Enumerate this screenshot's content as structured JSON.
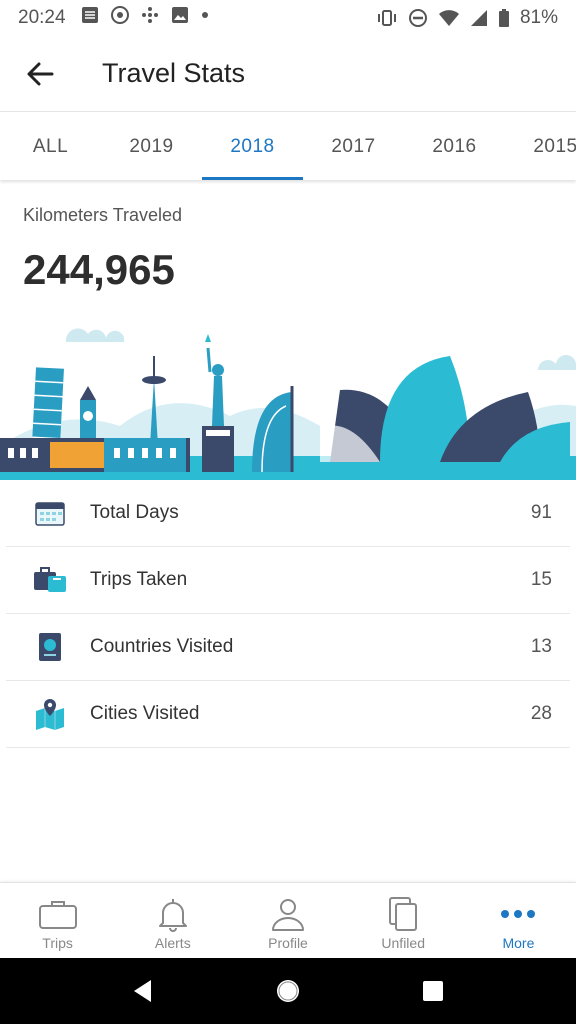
{
  "status_bar": {
    "time": "20:24",
    "battery_percent": "81%"
  },
  "app_bar": {
    "title": "Travel Stats"
  },
  "tabs": [
    {
      "label": "ALL",
      "active": false
    },
    {
      "label": "2019",
      "active": false
    },
    {
      "label": "2018",
      "active": true
    },
    {
      "label": "2017",
      "active": false
    },
    {
      "label": "2016",
      "active": false
    },
    {
      "label": "2015",
      "active": false
    }
  ],
  "kilometers": {
    "label": "Kilometers Traveled",
    "value": "244,965"
  },
  "stats": [
    {
      "label": "Total Days",
      "value": "91",
      "icon": "calendar-icon"
    },
    {
      "label": "Trips Taken",
      "value": "15",
      "icon": "luggage-icon"
    },
    {
      "label": "Countries Visited",
      "value": "13",
      "icon": "passport-icon"
    },
    {
      "label": "Cities Visited",
      "value": "28",
      "icon": "map-pin-icon"
    }
  ],
  "bottom_nav": [
    {
      "label": "Trips",
      "icon": "briefcase-icon",
      "active": false
    },
    {
      "label": "Alerts",
      "icon": "bell-icon",
      "active": false
    },
    {
      "label": "Profile",
      "icon": "person-icon",
      "active": false
    },
    {
      "label": "Unfiled",
      "icon": "documents-icon",
      "active": false
    },
    {
      "label": "More",
      "icon": "more-dots-icon",
      "active": true
    }
  ],
  "colors": {
    "accent": "#1d77c2",
    "teal": "#2bbcd4",
    "navy": "#3b4a6b"
  }
}
